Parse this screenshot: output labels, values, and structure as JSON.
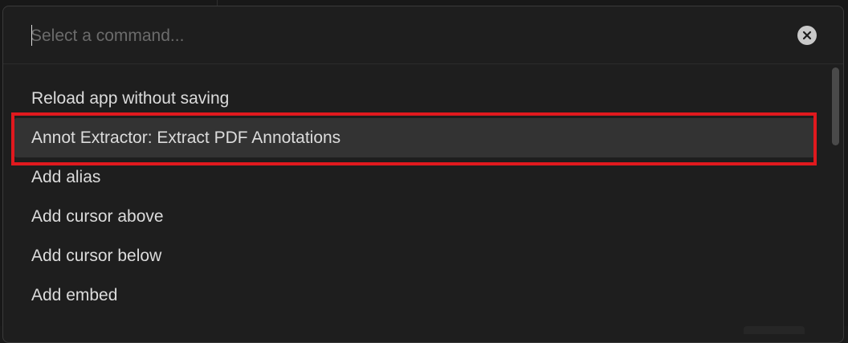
{
  "command_palette": {
    "search": {
      "placeholder": "Select a command...",
      "value": ""
    },
    "clear_icon": "close-circle-icon",
    "items": [
      {
        "label": "Reload app without saving",
        "selected": false
      },
      {
        "label": "Annot Extractor: Extract PDF Annotations",
        "selected": true
      },
      {
        "label": "Add alias",
        "selected": false
      },
      {
        "label": "Add cursor above",
        "selected": false
      },
      {
        "label": "Add cursor below",
        "selected": false
      },
      {
        "label": "Add embed",
        "selected": false
      }
    ]
  },
  "annotation": {
    "highlight_color": "#e0191e",
    "highlighted_item_index": 1
  },
  "colors": {
    "background": "#1e1e1e",
    "text": "#dcdcdc",
    "placeholder": "#6b6b6b",
    "selected_row": "#333333"
  }
}
